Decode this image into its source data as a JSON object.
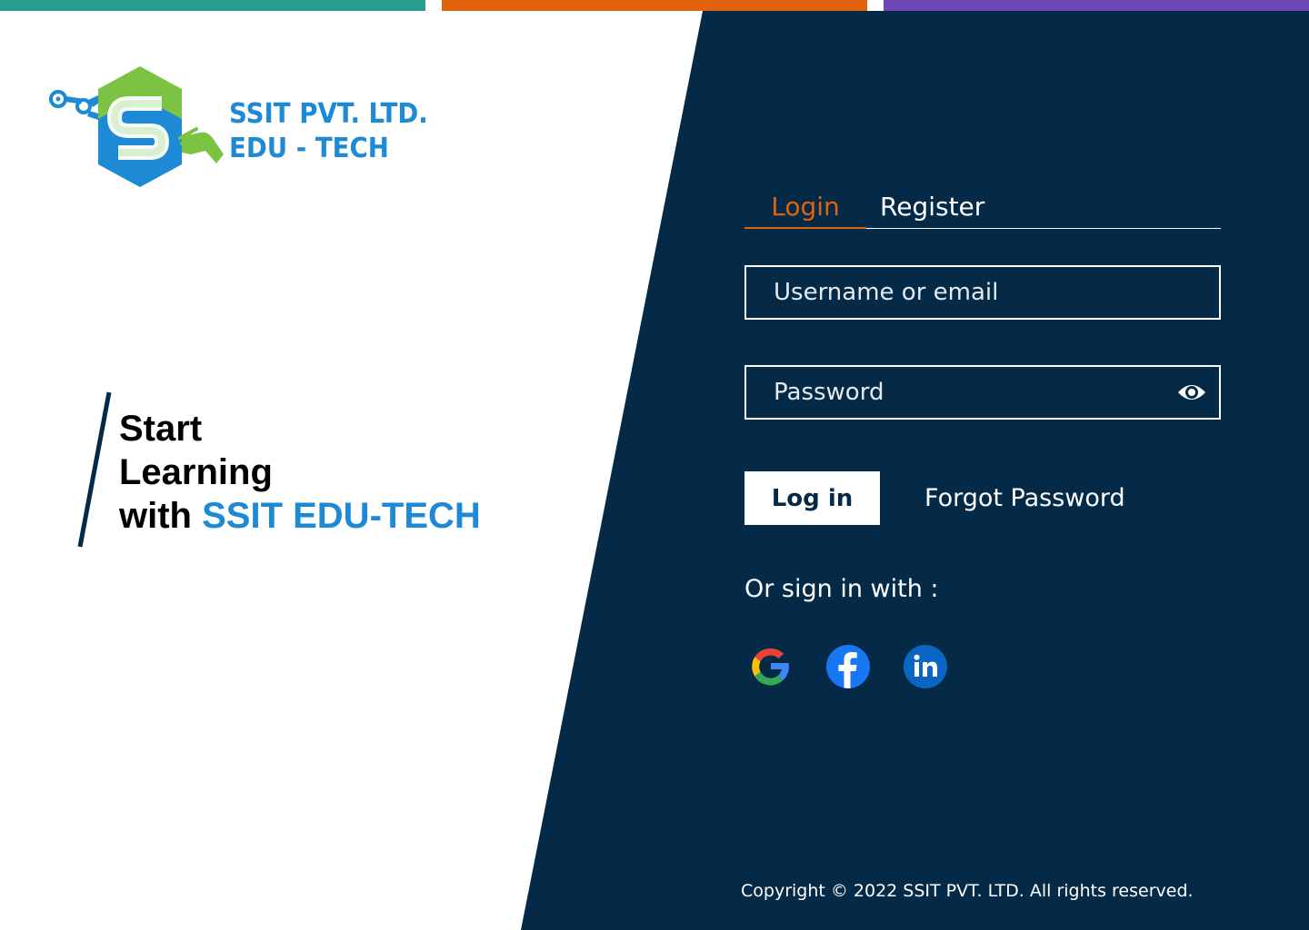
{
  "colors": {
    "accent_teal": "#2a9d8f",
    "accent_orange": "#e0620d",
    "accent_purple": "#6e47b5",
    "panel_navy": "#042a47",
    "brand_blue": "#1e8ad6",
    "brand_green": "#7cc243"
  },
  "brand": {
    "line1": "SSIT PVT. LTD.",
    "line2": "EDU - TECH"
  },
  "hero": {
    "line1": "Start",
    "line2": "Learning",
    "line3_prefix": "with ",
    "line3_highlight": "SSIT EDU-TECH"
  },
  "tabs": [
    {
      "label": "Login",
      "active": true
    },
    {
      "label": "Register",
      "active": false
    }
  ],
  "form": {
    "username_placeholder": "Username or email",
    "password_placeholder": "Password",
    "login_button": "Log in",
    "forgot_link": "Forgot Password"
  },
  "social": {
    "label": "Or sign in with :",
    "icons": [
      "google-icon",
      "facebook-icon",
      "linkedin-icon"
    ]
  },
  "footer": {
    "copyright": "Copyright © 2022 SSIT PVT. LTD. All rights reserved."
  }
}
